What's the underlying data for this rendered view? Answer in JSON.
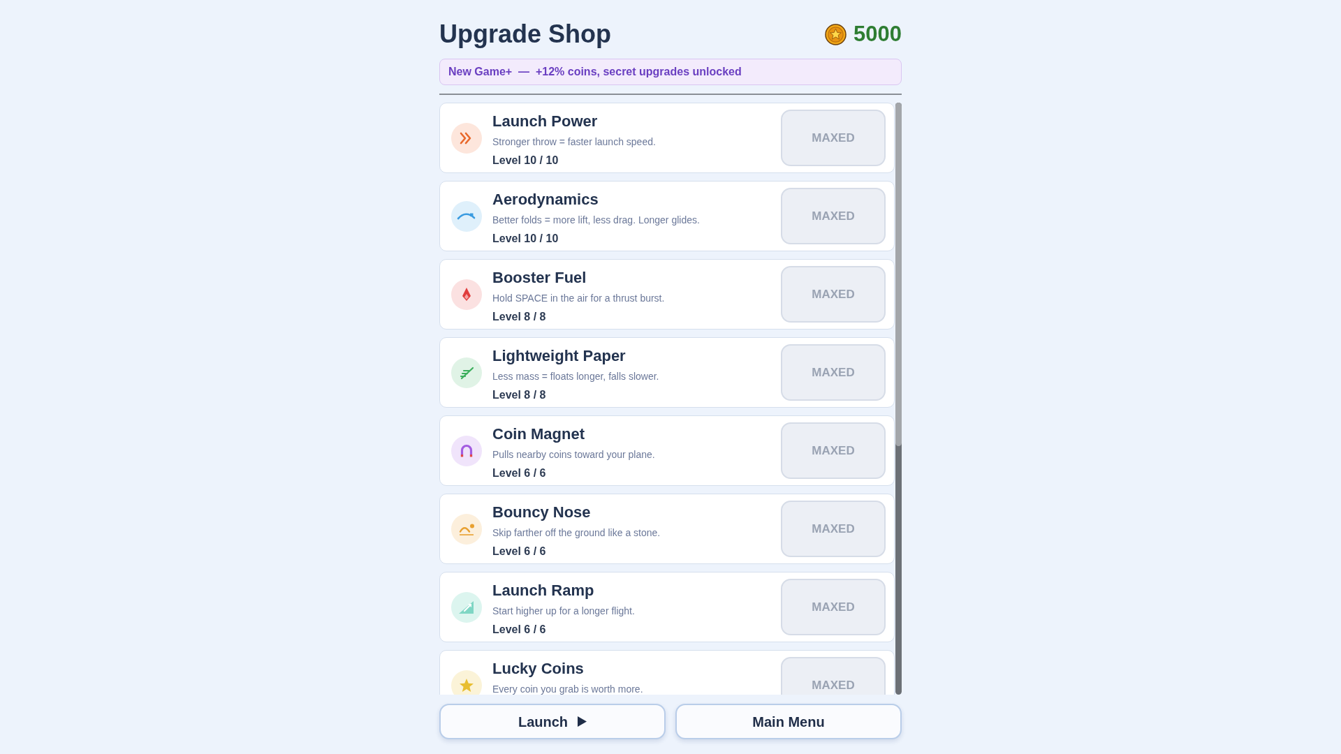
{
  "header": {
    "title": "Upgrade Shop",
    "coins": "5000"
  },
  "banner": {
    "text": "New Game+  —  +12% coins, secret upgrades unlocked"
  },
  "upgrades": [
    {
      "name": "Launch Power",
      "description": "Stronger throw = faster launch speed.",
      "level_label": "Level 10 / 10",
      "button": {
        "label": "MAXED",
        "disabled": true
      }
    },
    {
      "name": "Aerodynamics",
      "description": "Better folds = more lift, less drag. Longer glides.",
      "level_label": "Level 10 / 10",
      "button": {
        "label": "MAXED",
        "disabled": true
      }
    },
    {
      "name": "Booster Fuel",
      "description": "Hold SPACE in the air for a thrust burst.",
      "level_label": "Level 8 / 8",
      "button": {
        "label": "MAXED",
        "disabled": true
      }
    },
    {
      "name": "Lightweight Paper",
      "description": "Less mass = floats longer, falls slower.",
      "level_label": "Level 8 / 8",
      "button": {
        "label": "MAXED",
        "disabled": true
      }
    },
    {
      "name": "Coin Magnet",
      "description": "Pulls nearby coins toward your plane.",
      "level_label": "Level 6 / 6",
      "button": {
        "label": "MAXED",
        "disabled": true
      }
    },
    {
      "name": "Bouncy Nose",
      "description": "Skip farther off the ground like a stone.",
      "level_label": "Level 6 / 6",
      "button": {
        "label": "MAXED",
        "disabled": true
      }
    },
    {
      "name": "Launch Ramp",
      "description": "Start higher up for a longer flight.",
      "level_label": "Level 6 / 6",
      "button": {
        "label": "MAXED",
        "disabled": true
      }
    },
    {
      "name": "Lucky Coins",
      "description": "Every coin you grab is worth more.",
      "button": {
        "label": "MAXED",
        "disabled": true
      }
    }
  ],
  "footer_buttons": [
    {
      "label": "Launch",
      "kind": "play"
    },
    {
      "label": "Main Menu",
      "kind": "plain"
    }
  ]
}
